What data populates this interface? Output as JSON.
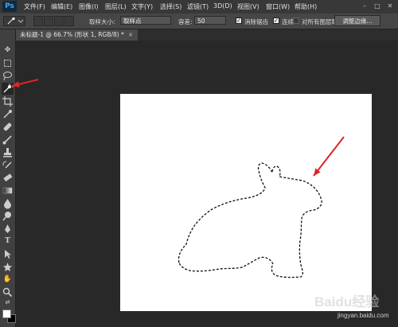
{
  "app": {
    "logo": "Ps"
  },
  "menu": {
    "items": [
      "文件(F)",
      "编辑(E)",
      "图像(I)",
      "图层(L)",
      "文字(Y)",
      "选择(S)",
      "滤镜(T)",
      "3D(D)",
      "视图(V)",
      "窗口(W)",
      "帮助(H)"
    ]
  },
  "window_controls": {
    "minimize": "–",
    "maximize": "□",
    "close": "✕"
  },
  "options": {
    "sample_size_label": "取样大小:",
    "sample_size_value": "取样点",
    "tolerance_label": "容差:",
    "tolerance_value": "50",
    "antialias_label": "消除锯齿",
    "antialias_checked": true,
    "contiguous_label": "连续",
    "contiguous_checked": true,
    "all_layers_label": "对所有图层取样",
    "all_layers_checked": false,
    "refine_edge_label": "调整边缘..."
  },
  "document": {
    "tab_title": "未标题-1 @ 66.7% (形状 1, RGB/8) *",
    "close": "×"
  },
  "tools": {
    "icons": [
      "move-icon",
      "marquee-icon",
      "lasso-icon",
      "magic-wand-icon",
      "crop-icon",
      "eyedropper-icon",
      "healing-brush-icon",
      "brush-icon",
      "clone-stamp-icon",
      "history-brush-icon",
      "eraser-icon",
      "gradient-icon",
      "blur-icon",
      "dodge-icon",
      "pen-icon",
      "type-icon",
      "path-selection-icon",
      "shape-icon",
      "hand-icon",
      "zoom-icon"
    ],
    "selected": "magic-wand-icon"
  },
  "colors": {
    "foreground": "#ffffff",
    "background": "#000000",
    "annotation_arrow": "#e02424",
    "canvas": "#ffffff"
  },
  "watermark": {
    "text": "Baidu经验",
    "url": "jingyan.baidu.com"
  }
}
